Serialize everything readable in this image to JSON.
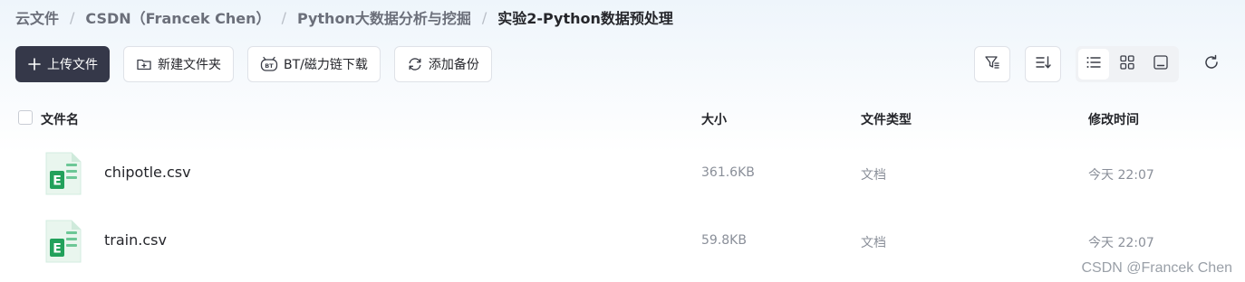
{
  "breadcrumb": {
    "items": [
      "云文件",
      "CSDN（Francek Chen）",
      "Python大数据分析与挖掘",
      "实验2-Python数据预处理"
    ],
    "separator": "/"
  },
  "toolbar": {
    "upload_label": "上传文件",
    "new_folder_label": "新建文件夹",
    "bt_label": "BT/磁力链下载",
    "backup_label": "添加备份"
  },
  "table": {
    "headers": {
      "name": "文件名",
      "size": "大小",
      "type": "文件类型",
      "modified": "修改时间"
    },
    "rows": [
      {
        "name": "chipotle.csv",
        "size": "361.6KB",
        "type": "文档",
        "modified": "今天 22:07"
      },
      {
        "name": "train.csv",
        "size": "59.8KB",
        "type": "文档",
        "modified": "今天 22:07"
      }
    ]
  },
  "watermark": "CSDN @Francek Chen",
  "colors": {
    "primary": "#353849",
    "file_green": "#22a15b"
  },
  "icons": [
    "plus-icon",
    "folder-plus-icon",
    "bt-icon",
    "backup-icon",
    "filter-icon",
    "sort-icon",
    "list-view-icon",
    "grid-view-icon",
    "preview-view-icon",
    "refresh-icon",
    "excel-file-icon"
  ]
}
